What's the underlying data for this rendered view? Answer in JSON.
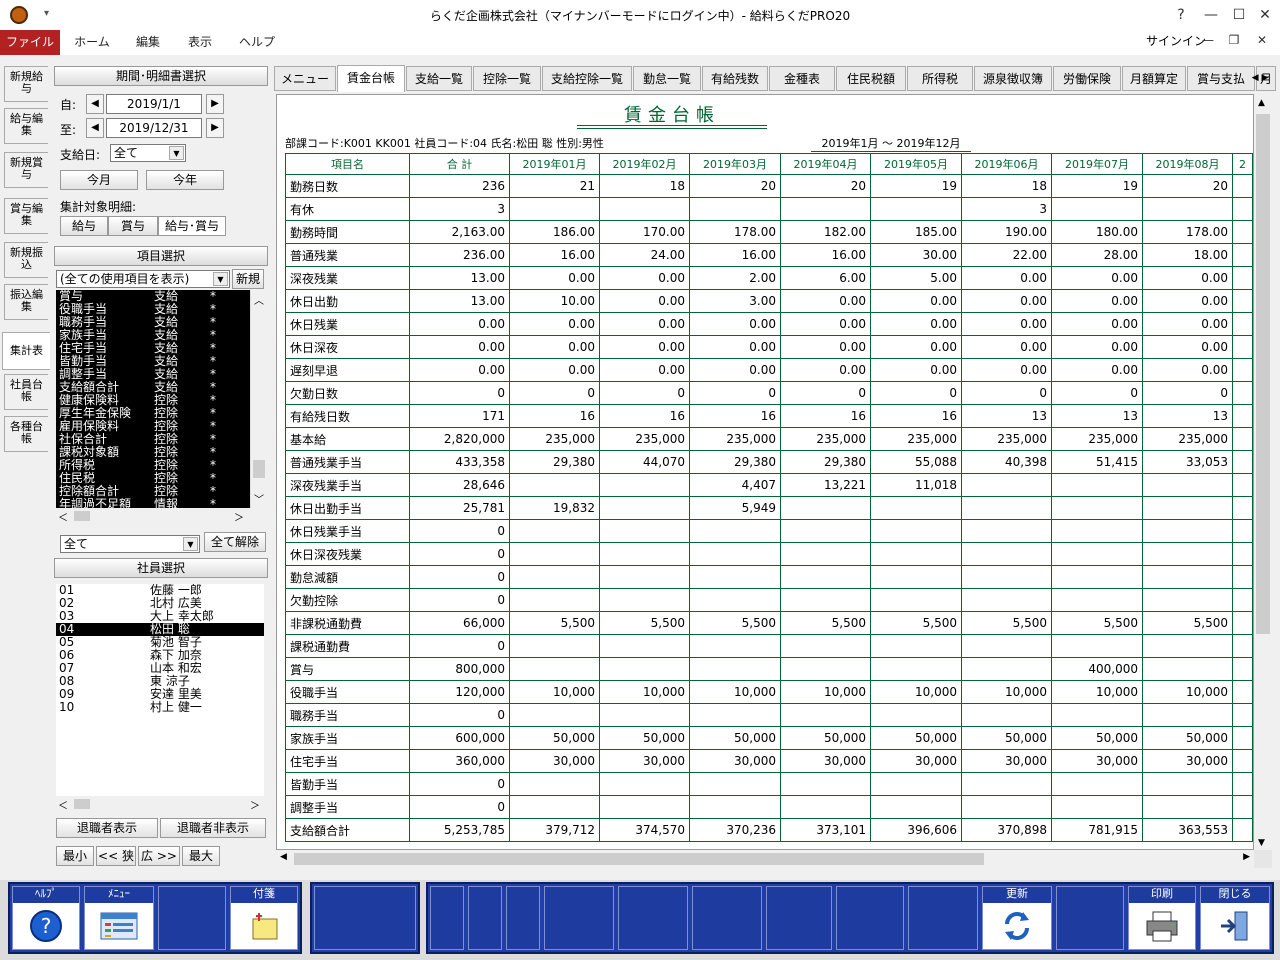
{
  "window": {
    "title": "らくだ企画株式会社（マイナンバーモードにログイン中）- 給料らくだPRO20",
    "min": "?",
    "max": "—",
    "restore": "☐",
    "close": "✕"
  },
  "ribbon": {
    "file": "ファイル",
    "home": "ホーム",
    "edit": "編集",
    "view": "表示",
    "help": "ヘルプ",
    "signin": "サインイン"
  },
  "vtabs": [
    "新規給与",
    "給与編集",
    "新規賞与",
    "賞与編集",
    "新規振込",
    "振込編集",
    "集計表",
    "社員台帳",
    "各種台帳"
  ],
  "left": {
    "period_header": "期間･明細書選択",
    "from_label": "自:",
    "from_date": "2019/1/1",
    "to_label": "至:",
    "to_date": "2019/12/31",
    "payday_label": "支給日:",
    "payday_value": "全て",
    "btn_month": "今月",
    "btn_year": "今年",
    "target_label": "集計対象明細:",
    "btn_salary": "給与",
    "btn_bonus": "賞与",
    "btn_both": "給与･賞与",
    "item_header": "項目選択",
    "item_filter": "(全ての使用項目を表示)",
    "btn_new": "新規",
    "items": [
      [
        "賞与",
        "支給",
        "*"
      ],
      [
        "役職手当",
        "支給",
        "*"
      ],
      [
        "職務手当",
        "支給",
        "*"
      ],
      [
        "家族手当",
        "支給",
        "*"
      ],
      [
        "住宅手当",
        "支給",
        "*"
      ],
      [
        "皆勤手当",
        "支給",
        "*"
      ],
      [
        "調整手当",
        "支給",
        "*"
      ],
      [
        "支給額合計",
        "支給",
        "*"
      ],
      [
        "健康保険料",
        "控除",
        "*"
      ],
      [
        "厚生年金保険",
        "控除",
        "*"
      ],
      [
        "雇用保険料",
        "控除",
        "*"
      ],
      [
        "社保合計",
        "控除",
        "*"
      ],
      [
        "課税対象額",
        "控除",
        "*"
      ],
      [
        "所得税",
        "控除",
        "*"
      ],
      [
        "住民税",
        "控除",
        "*"
      ],
      [
        "控除額合計",
        "控除",
        "*"
      ],
      [
        "年調過不足額",
        "情報",
        "*"
      ]
    ],
    "emp_filter": "全て",
    "btn_clear_all": "全て解除",
    "emp_header": "社員選択",
    "employees": [
      [
        "01",
        "佐藤 一郎"
      ],
      [
        "02",
        "北村 広美"
      ],
      [
        "03",
        "大上 幸太郎"
      ],
      [
        "04",
        "松田 聡"
      ],
      [
        "05",
        "菊池 智子"
      ],
      [
        "06",
        "森下 加奈"
      ],
      [
        "07",
        "山本 和宏"
      ],
      [
        "08",
        "東 涼子"
      ],
      [
        "09",
        "安達 里美"
      ],
      [
        "10",
        "村上 健一"
      ]
    ],
    "btn_show_retired": "退職者表示",
    "btn_hide_retired": "退職者非表示",
    "zoom": [
      "最小",
      "<< 狭",
      "広 >>",
      "最大"
    ]
  },
  "tabs": [
    "メニュー",
    "賃金台帳",
    "支給一覧",
    "控除一覧",
    "支給控除一覧",
    "勤怠一覧",
    "有給残数",
    "金種表",
    "住民税額",
    "所得税",
    "源泉徴収簿",
    "労働保険",
    "月額算定",
    "賞与支払",
    "月"
  ],
  "report": {
    "title": "賃金台帳",
    "info": "部課コード:K001 KK001  社員コード:04  氏名:松田 聡  性別:男性",
    "period": "2019年1月 〜 2019年12月",
    "columns": [
      "項目名",
      "合 計",
      "2019年01月",
      "2019年02月",
      "2019年03月",
      "2019年04月",
      "2019年05月",
      "2019年06月",
      "2019年07月",
      "2019年08月",
      "2"
    ],
    "rows": [
      [
        "勤務日数",
        "236",
        "21",
        "18",
        "20",
        "20",
        "19",
        "18",
        "19",
        "20",
        ""
      ],
      [
        "有休",
        "3",
        "",
        "",
        "",
        "",
        "",
        "3",
        "",
        "",
        ""
      ],
      [
        "勤務時間",
        "2,163.00",
        "186.00",
        "170.00",
        "178.00",
        "182.00",
        "185.00",
        "190.00",
        "180.00",
        "178.00",
        ""
      ],
      [
        "普通残業",
        "236.00",
        "16.00",
        "24.00",
        "16.00",
        "16.00",
        "30.00",
        "22.00",
        "28.00",
        "18.00",
        ""
      ],
      [
        "深夜残業",
        "13.00",
        "0.00",
        "0.00",
        "2.00",
        "6.00",
        "5.00",
        "0.00",
        "0.00",
        "0.00",
        ""
      ],
      [
        "休日出勤",
        "13.00",
        "10.00",
        "0.00",
        "3.00",
        "0.00",
        "0.00",
        "0.00",
        "0.00",
        "0.00",
        ""
      ],
      [
        "休日残業",
        "0.00",
        "0.00",
        "0.00",
        "0.00",
        "0.00",
        "0.00",
        "0.00",
        "0.00",
        "0.00",
        ""
      ],
      [
        "休日深夜",
        "0.00",
        "0.00",
        "0.00",
        "0.00",
        "0.00",
        "0.00",
        "0.00",
        "0.00",
        "0.00",
        ""
      ],
      [
        "遅刻早退",
        "0.00",
        "0.00",
        "0.00",
        "0.00",
        "0.00",
        "0.00",
        "0.00",
        "0.00",
        "0.00",
        ""
      ],
      [
        "欠勤日数",
        "0",
        "0",
        "0",
        "0",
        "0",
        "0",
        "0",
        "0",
        "0",
        ""
      ],
      [
        "有給残日数",
        "171",
        "16",
        "16",
        "16",
        "16",
        "16",
        "13",
        "13",
        "13",
        ""
      ],
      [
        "基本給",
        "2,820,000",
        "235,000",
        "235,000",
        "235,000",
        "235,000",
        "235,000",
        "235,000",
        "235,000",
        "235,000",
        ""
      ],
      [
        "普通残業手当",
        "433,358",
        "29,380",
        "44,070",
        "29,380",
        "29,380",
        "55,088",
        "40,398",
        "51,415",
        "33,053",
        ""
      ],
      [
        "深夜残業手当",
        "28,646",
        "",
        "",
        "4,407",
        "13,221",
        "11,018",
        "",
        "",
        "",
        ""
      ],
      [
        "休日出勤手当",
        "25,781",
        "19,832",
        "",
        "5,949",
        "",
        "",
        "",
        "",
        "",
        ""
      ],
      [
        "休日残業手当",
        "0",
        "",
        "",
        "",
        "",
        "",
        "",
        "",
        "",
        ""
      ],
      [
        "休日深夜残業",
        "0",
        "",
        "",
        "",
        "",
        "",
        "",
        "",
        "",
        ""
      ],
      [
        "勤怠減額",
        "0",
        "",
        "",
        "",
        "",
        "",
        "",
        "",
        "",
        ""
      ],
      [
        "欠勤控除",
        "0",
        "",
        "",
        "",
        "",
        "",
        "",
        "",
        "",
        ""
      ],
      [
        "非課税通勤費",
        "66,000",
        "5,500",
        "5,500",
        "5,500",
        "5,500",
        "5,500",
        "5,500",
        "5,500",
        "5,500",
        ""
      ],
      [
        "課税通勤費",
        "0",
        "",
        "",
        "",
        "",
        "",
        "",
        "",
        "",
        ""
      ],
      [
        "賞与",
        "800,000",
        "",
        "",
        "",
        "",
        "",
        "",
        "400,000",
        "",
        ""
      ],
      [
        "役職手当",
        "120,000",
        "10,000",
        "10,000",
        "10,000",
        "10,000",
        "10,000",
        "10,000",
        "10,000",
        "10,000",
        ""
      ],
      [
        "職務手当",
        "0",
        "",
        "",
        "",
        "",
        "",
        "",
        "",
        "",
        ""
      ],
      [
        "家族手当",
        "600,000",
        "50,000",
        "50,000",
        "50,000",
        "50,000",
        "50,000",
        "50,000",
        "50,000",
        "50,000",
        ""
      ],
      [
        "住宅手当",
        "360,000",
        "30,000",
        "30,000",
        "30,000",
        "30,000",
        "30,000",
        "30,000",
        "30,000",
        "30,000",
        ""
      ],
      [
        "皆勤手当",
        "0",
        "",
        "",
        "",
        "",
        "",
        "",
        "",
        "",
        ""
      ],
      [
        "調整手当",
        "0",
        "",
        "",
        "",
        "",
        "",
        "",
        "",
        "",
        ""
      ],
      [
        "支給額合計",
        "5,253,785",
        "379,712",
        "374,570",
        "370,236",
        "373,101",
        "396,606",
        "370,898",
        "781,915",
        "363,553",
        ""
      ]
    ]
  },
  "toolbar": {
    "help": "ﾍﾙﾌﾟ",
    "menu": "ﾒﾆｭｰ",
    "tag": "付箋",
    "refresh": "更新",
    "print": "印刷",
    "close": "閉じる"
  },
  "colors": {
    "file_menu": "#b22222",
    "grid_line": "#006633",
    "toolbar_blue": "#1e3c9f"
  }
}
